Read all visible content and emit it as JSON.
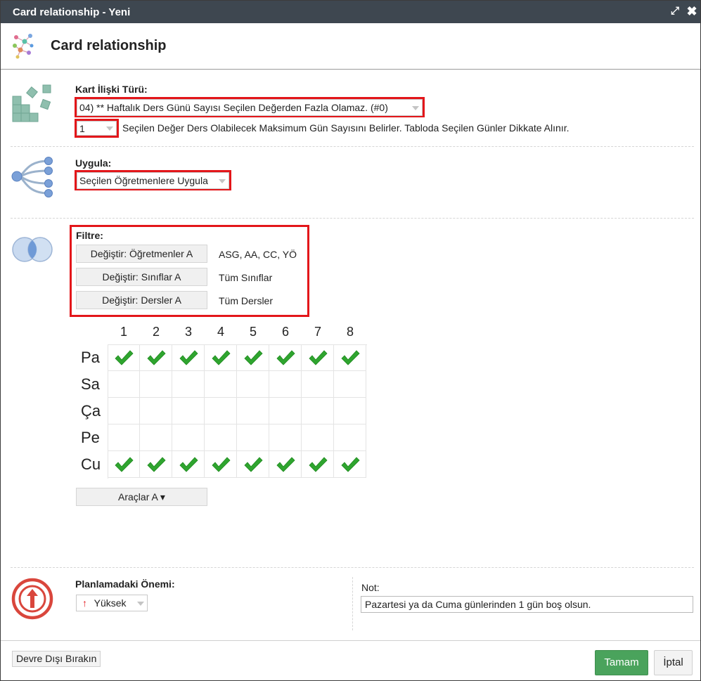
{
  "window": {
    "title": "Card relationship - Yeni",
    "maximize_icon": "⤢",
    "close_icon": "✖"
  },
  "header": {
    "title": "Card relationship",
    "icon": "network-icon"
  },
  "relation_type": {
    "label": "Kart İlişki Türü:",
    "selected": "04) ** Haftalık Ders Günü Sayısı Seçilen Değerden Fazla Olamaz. (#0)",
    "value_selected": "1",
    "description": "Seçilen Değer Ders Olabilecek Maksimum Gün Sayısını Belirler. Tabloda Seçilen Günler Dikkate Alınır."
  },
  "apply": {
    "label": "Uygula:",
    "selected": "Seçilen Öğretmenlere Uygula"
  },
  "filter": {
    "label": "Filtre:",
    "rows": [
      {
        "button": "Değiştir: Öğretmenler A",
        "value": "ASG, AA, CC, YÖ"
      },
      {
        "button": "Değiştir: Sınıflar A",
        "value": "Tüm Sınıflar"
      },
      {
        "button": "Değiştir: Dersler A",
        "value": "Tüm Dersler"
      }
    ]
  },
  "grid": {
    "columns": [
      "1",
      "2",
      "3",
      "4",
      "5",
      "6",
      "7",
      "8"
    ],
    "rows": [
      {
        "day": "Pa",
        "checked": [
          true,
          true,
          true,
          true,
          true,
          true,
          true,
          true
        ]
      },
      {
        "day": "Sa",
        "checked": [
          false,
          false,
          false,
          false,
          false,
          false,
          false,
          false
        ]
      },
      {
        "day": "Ça",
        "checked": [
          false,
          false,
          false,
          false,
          false,
          false,
          false,
          false
        ]
      },
      {
        "day": "Pe",
        "checked": [
          false,
          false,
          false,
          false,
          false,
          false,
          false,
          false
        ]
      },
      {
        "day": "Cu",
        "checked": [
          true,
          true,
          true,
          true,
          true,
          true,
          true,
          true
        ]
      }
    ],
    "tools_button": "Araçlar A ▾"
  },
  "importance": {
    "label": "Planlamadaki Önemi:",
    "selected": "Yüksek",
    "arrow_icon": "↑"
  },
  "note": {
    "label": "Not:",
    "value": "Pazartesi ya da Cuma günlerinden 1 gün boş olsun."
  },
  "footer": {
    "disable_button": "Devre Dışı Bırakın",
    "ok_button": "Tamam",
    "cancel_button": "İptal"
  },
  "colors": {
    "titlebar": "#3e4750",
    "highlight": "#e3161a",
    "ok": "#4aa35c",
    "check": "#2fa52f",
    "importance": "#d9463c"
  }
}
